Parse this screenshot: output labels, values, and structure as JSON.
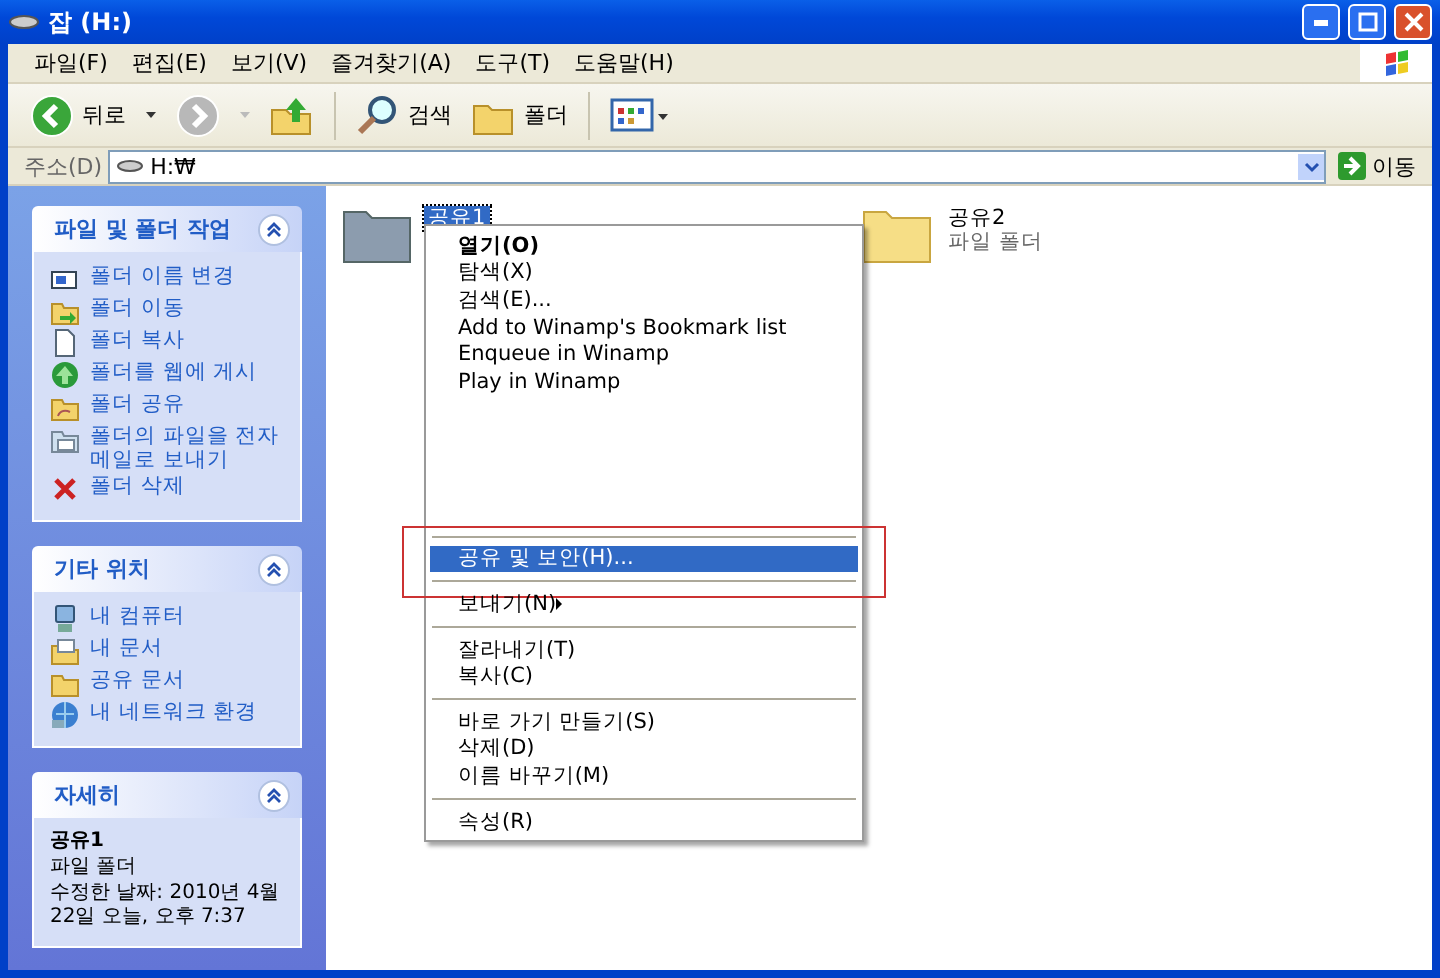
{
  "window": {
    "title": "잡 (H:)"
  },
  "menu_bar": [
    "파일(F)",
    "편집(E)",
    "보기(V)",
    "즐겨찾기(A)",
    "도구(T)",
    "도움말(H)"
  ],
  "toolbar": {
    "back": {
      "label": "뒤로",
      "disabled": false
    },
    "forward": {
      "disabled": true
    },
    "search": "검색",
    "folders": "폴더"
  },
  "address_bar": {
    "label": "주소(D)",
    "value": "H:₩",
    "go": "이동"
  },
  "task_panes": [
    {
      "kind": "tasks",
      "title": "파일 및 폴더 작업",
      "expanded": true,
      "items": [
        {
          "label": "폴더 이름 변경"
        },
        {
          "label": "폴더 이동"
        },
        {
          "label": "폴더 복사"
        },
        {
          "label": "폴더를 웹에 게시"
        },
        {
          "label": "폴더 공유"
        },
        {
          "label": "폴더의 파일을 전자 메일로 보내기"
        },
        {
          "label": "폴더 삭제"
        }
      ]
    },
    {
      "kind": "tasks",
      "title": "기타 위치",
      "expanded": true,
      "items": [
        {
          "label": "내 컴퓨터"
        },
        {
          "label": "내 문서"
        },
        {
          "label": "공유 문서"
        },
        {
          "label": "내 네트워크 환경"
        }
      ]
    },
    {
      "kind": "details",
      "title": "자세히",
      "expanded": true,
      "name": "공유1",
      "type": "파일 폴더",
      "modified": "수정한 날짜: 2010년 4월 22일 오늘, 오후 7:37"
    }
  ],
  "folders": [
    {
      "name": "공유1",
      "selected": true
    },
    {
      "name": "공유2",
      "type": "파일 폴더",
      "selected": false
    }
  ],
  "context_menu": {
    "items": [
      {
        "kind": "item",
        "label": "열기(O)",
        "default": true,
        "selected": false
      },
      {
        "kind": "item",
        "label": "탐색(X)",
        "default": false,
        "selected": false
      },
      {
        "kind": "item",
        "label": "검색(E)...",
        "default": false,
        "selected": false
      },
      {
        "kind": "item",
        "label": "Add to Winamp's Bookmark list",
        "default": false,
        "selected": false
      },
      {
        "kind": "item",
        "label": "Enqueue in Winamp",
        "default": false,
        "selected": false
      },
      {
        "kind": "item",
        "label": "Play in Winamp",
        "default": false,
        "selected": false
      },
      {
        "kind": "gap"
      },
      {
        "kind": "separator"
      },
      {
        "kind": "item",
        "label": "공유 및 보안(H)...",
        "default": false,
        "selected": true,
        "annotated": true
      },
      {
        "kind": "separator"
      },
      {
        "kind": "item",
        "label": "보내기(N)",
        "default": false,
        "selected": false,
        "submenu": true
      },
      {
        "kind": "separator"
      },
      {
        "kind": "item",
        "label": "잘라내기(T)",
        "default": false,
        "selected": false
      },
      {
        "kind": "item",
        "label": "복사(C)",
        "default": false,
        "selected": false
      },
      {
        "kind": "separator"
      },
      {
        "kind": "item",
        "label": "바로 가기 만들기(S)",
        "default": false,
        "selected": false
      },
      {
        "kind": "item",
        "label": "삭제(D)",
        "default": false,
        "selected": false
      },
      {
        "kind": "item",
        "label": "이름 바꾸기(M)",
        "default": false,
        "selected": false
      },
      {
        "kind": "separator"
      },
      {
        "kind": "item",
        "label": "속성(R)",
        "default": false,
        "selected": false
      }
    ]
  }
}
